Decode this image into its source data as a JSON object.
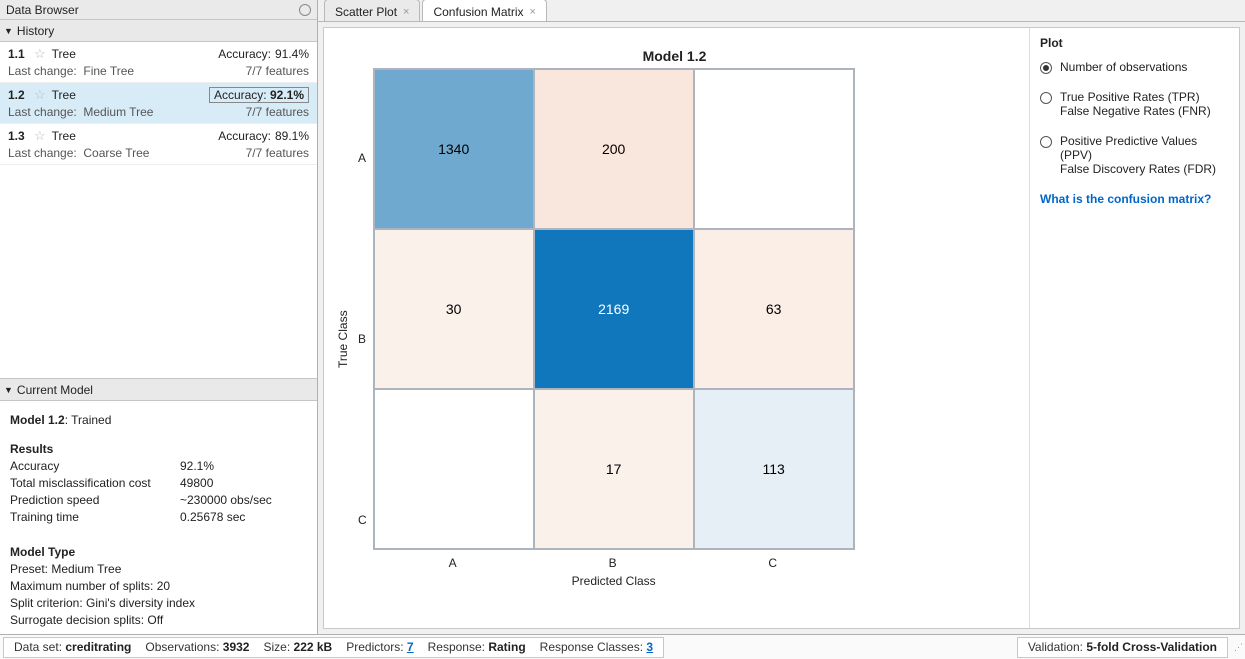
{
  "left": {
    "data_browser_title": "Data Browser",
    "history_title": "History",
    "items": [
      {
        "id": "1.1",
        "name": "Tree",
        "acc_label": "Accuracy:",
        "acc_val": "91.4%",
        "last_change_label": "Last change:",
        "last_change": "Fine Tree",
        "features": "7/7 features",
        "selected": false
      },
      {
        "id": "1.2",
        "name": "Tree",
        "acc_label": "Accuracy:",
        "acc_val": "92.1%",
        "last_change_label": "Last change:",
        "last_change": "Medium Tree",
        "features": "7/7 features",
        "selected": true
      },
      {
        "id": "1.3",
        "name": "Tree",
        "acc_label": "Accuracy:",
        "acc_val": "89.1%",
        "last_change_label": "Last change:",
        "last_change": "Coarse Tree",
        "features": "7/7 features",
        "selected": false
      }
    ],
    "current_model_title": "Current Model",
    "current_model": {
      "header": "Model 1.2",
      "header_suffix": ": Trained",
      "results_title": "Results",
      "rows": [
        {
          "k": "Accuracy",
          "v": "92.1%"
        },
        {
          "k": "Total misclassification cost",
          "v": "49800"
        },
        {
          "k": "Prediction speed",
          "v": "~230000 obs/sec"
        },
        {
          "k": "Training time",
          "v": "0.25678 sec"
        }
      ],
      "model_type_title": "Model Type",
      "model_type_lines": [
        "Preset: Medium Tree",
        "Maximum number of splits: 20",
        "Split criterion: Gini's diversity index",
        "Surrogate decision splits: Off"
      ]
    }
  },
  "tabs": [
    {
      "label": "Scatter Plot",
      "active": false
    },
    {
      "label": "Confusion Matrix",
      "active": true
    }
  ],
  "chart_data": {
    "type": "heatmap",
    "title": "Model 1.2",
    "xlabel": "Predicted Class",
    "ylabel": "True Class",
    "x_categories": [
      "A",
      "B",
      "C"
    ],
    "y_categories": [
      "A",
      "B",
      "C"
    ],
    "values": [
      [
        1340,
        200,
        null
      ],
      [
        30,
        2169,
        63
      ],
      [
        null,
        17,
        113
      ]
    ],
    "cell_colors": [
      [
        "#6fa9cf",
        "#f9e6dd",
        "#ffffff"
      ],
      [
        "#fbf1eb",
        "#1077bd",
        "#faeee7"
      ],
      [
        "#ffffff",
        "#fbf1eb",
        "#e6eff5"
      ]
    ],
    "cell_text_colors": [
      [
        "#000",
        "#000",
        "#000"
      ],
      [
        "#000",
        "#fff",
        "#000"
      ],
      [
        "#000",
        "#000",
        "#000"
      ]
    ]
  },
  "plot_options": {
    "header": "Plot",
    "options": [
      {
        "lines": [
          "Number of observations"
        ],
        "selected": true
      },
      {
        "lines": [
          "True Positive Rates (TPR)",
          "False Negative Rates (FNR)"
        ],
        "selected": false
      },
      {
        "lines": [
          "Positive Predictive Values (PPV)",
          "False Discovery Rates (FDR)"
        ],
        "selected": false
      }
    ],
    "help_link": "What is the confusion matrix?"
  },
  "status": {
    "data_set_label": "Data set:",
    "data_set": "creditrating",
    "observations_label": "Observations:",
    "observations": "3932",
    "size_label": "Size:",
    "size": "222 kB",
    "predictors_label": "Predictors:",
    "predictors": "7",
    "response_label": "Response:",
    "response": "Rating",
    "response_classes_label": "Response Classes:",
    "response_classes": "3",
    "validation_label": "Validation:",
    "validation": "5-fold Cross-Validation"
  }
}
